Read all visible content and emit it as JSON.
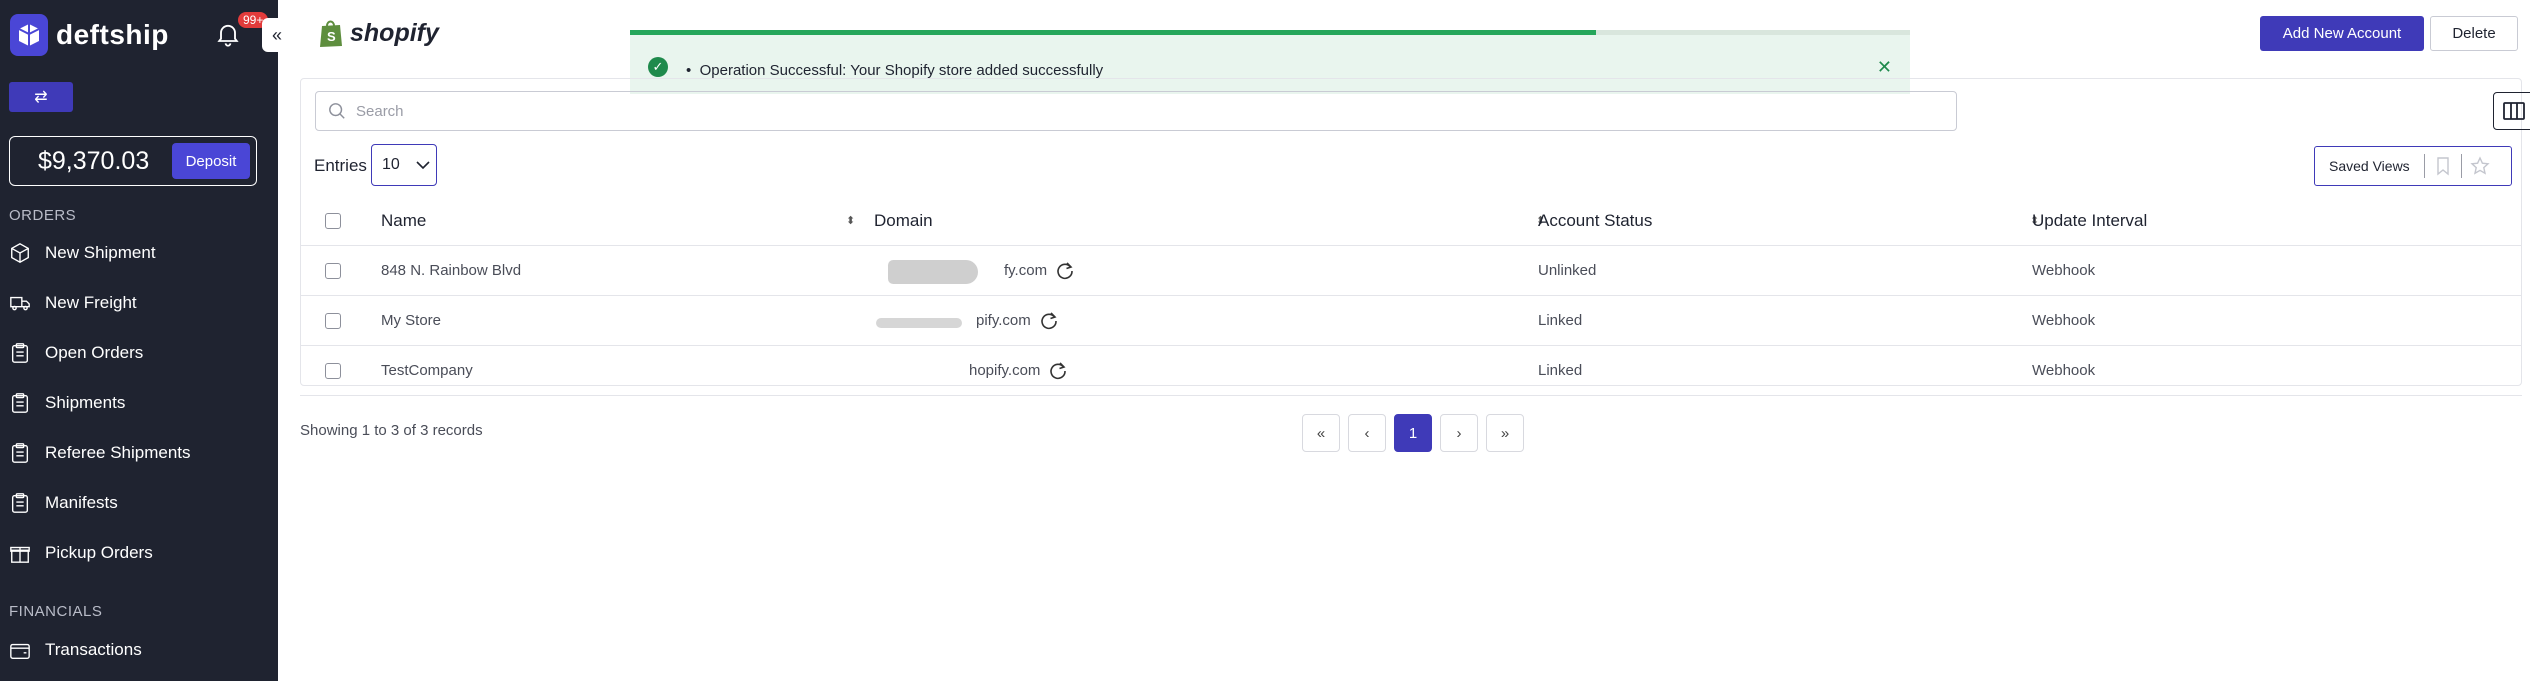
{
  "brand": {
    "name": "deftship",
    "notification_count": "99+"
  },
  "wallet": {
    "balance": "$9,370.03",
    "deposit_label": "Deposit"
  },
  "sidebar": {
    "orders_section": "ORDERS",
    "orders_items": [
      {
        "label": "New Shipment",
        "icon": "box-icon"
      },
      {
        "label": "New Freight",
        "icon": "truck-icon"
      },
      {
        "label": "Open Orders",
        "icon": "clipboard-icon"
      },
      {
        "label": "Shipments",
        "icon": "clipboard-icon"
      },
      {
        "label": "Referee Shipments",
        "icon": "clipboard-icon"
      },
      {
        "label": "Manifests",
        "icon": "clipboard-icon"
      },
      {
        "label": "Pickup Orders",
        "icon": "gift-box-icon"
      }
    ],
    "financials_section": "FINANCIALS",
    "financials_items": [
      {
        "label": "Transactions",
        "icon": "wallet-icon"
      }
    ]
  },
  "header": {
    "integration": "shopify",
    "add_button": "Add New Account",
    "delete_button": "Delete"
  },
  "toast": {
    "message": "Operation Successful: Your Shopify store added successfully",
    "progress": 0.755
  },
  "toolbar": {
    "search_placeholder": "Search",
    "entries_label": "Entries",
    "entries_value": "10",
    "saved_views_label": "Saved Views"
  },
  "table": {
    "columns": [
      "Name",
      "Domain",
      "Account Status",
      "Update Interval"
    ],
    "rows": [
      {
        "name": "848 N. Rainbow Blvd",
        "domain": "fy.com",
        "status": "Unlinked",
        "interval": "Webhook"
      },
      {
        "name": "My Store",
        "domain": "pify.com",
        "status": "Linked",
        "interval": "Webhook"
      },
      {
        "name": "TestCompany",
        "domain": "hopify.com",
        "status": "Linked",
        "interval": "Webhook"
      }
    ]
  },
  "footer": {
    "showing": "Showing 1 to 3 of 3 records",
    "current_page": "1"
  },
  "colors": {
    "sidebar_bg": "#1f2330",
    "primary": "#3f3ab8",
    "success": "#26a65b",
    "toast_bg": "#e9f5ee"
  }
}
